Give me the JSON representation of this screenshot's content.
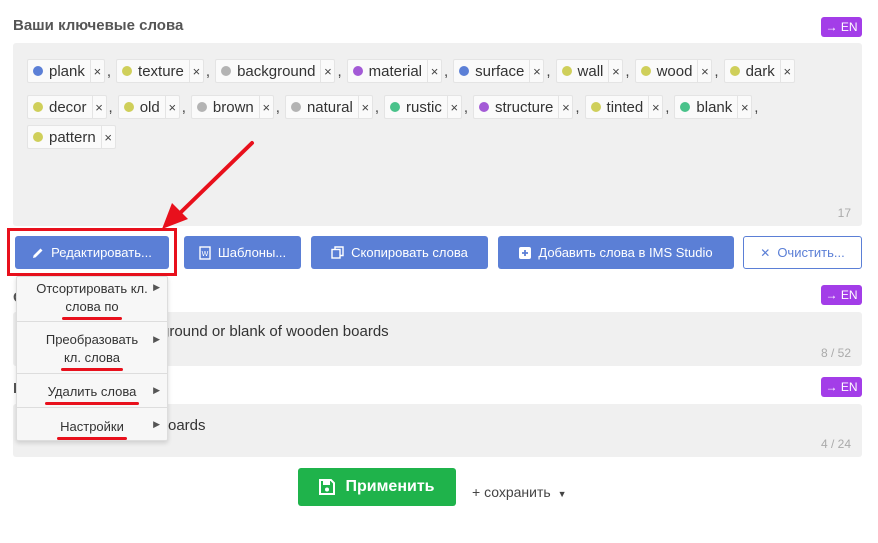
{
  "keywords_section": {
    "title": "Ваши ключевые слова",
    "lang_badge": "→ EN",
    "count": "17",
    "keywords": [
      {
        "label": "plank",
        "color": "#5b7fd6"
      },
      {
        "label": "texture",
        "color": "#cfcf5a"
      },
      {
        "label": "background",
        "color": "#b3b3b3"
      },
      {
        "label": "material",
        "color": "#a35ad6"
      },
      {
        "label": "surface",
        "color": "#5b7fd6"
      },
      {
        "label": "wall",
        "color": "#cfcf5a"
      },
      {
        "label": "wood",
        "color": "#cfcf5a"
      },
      {
        "label": "dark",
        "color": "#cfcf5a"
      },
      {
        "label": "decor",
        "color": "#cfcf5a"
      },
      {
        "label": "old",
        "color": "#cfcf5a"
      },
      {
        "label": "brown",
        "color": "#b3b3b3"
      },
      {
        "label": "natural",
        "color": "#b3b3b3"
      },
      {
        "label": "rustic",
        "color": "#49c28a"
      },
      {
        "label": "structure",
        "color": "#a35ad6"
      },
      {
        "label": "tinted",
        "color": "#cfcf5a"
      },
      {
        "label": "blank",
        "color": "#49c28a"
      },
      {
        "label": "pattern",
        "color": "#cfcf5a"
      }
    ],
    "remove_symbol": "×",
    "separator": ","
  },
  "toolbar": {
    "edit_label": "Редактировать...",
    "templates_label": "Шаблоны...",
    "copy_label": "Скопировать слова",
    "add_ims_label": "Добавить слова в IMS Studio",
    "clear_label": "Очистить..."
  },
  "dropdown": {
    "sort_line1": "Отсортировать кл.",
    "sort_line2": "слова по",
    "convert_line1": "Преобразовать",
    "convert_line2": "кл. слова",
    "delete_label": "Удалить слова",
    "settings_label": "Настройки"
  },
  "description": {
    "lang_badge": "→ EN",
    "label_fragment": "О",
    "text_fragment": "ground or blank of wooden boards",
    "count": "8 / 52"
  },
  "title_field": {
    "lang_badge": "→ EN",
    "label_fragment": "Н",
    "text_fragment": "oards",
    "count": "4 / 24"
  },
  "footer": {
    "apply_label": "Применить",
    "save_label": "+ сохранить"
  }
}
